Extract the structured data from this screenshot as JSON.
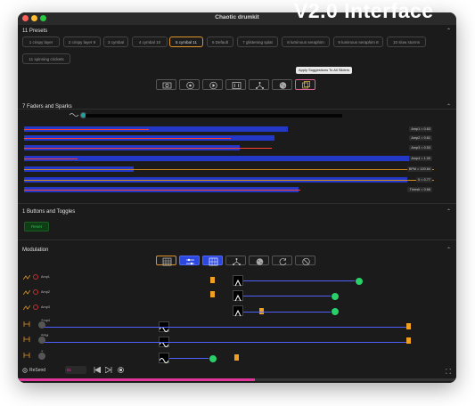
{
  "window": {
    "title": "Chaotic drumkit"
  },
  "overlay_text": "V2.0 Interface",
  "presets": {
    "section_title": "11 Presets",
    "items": [
      "1 crispy layer",
      "2 crispy layer 9",
      "3 cymbal",
      "4 cymbal 10",
      "5 cymbal 11",
      "6 Default",
      "7 glistening splat",
      "8 luminous seraphim",
      "9 luminous seraphim 8",
      "10 slow storms",
      "11 spinning crickets"
    ],
    "active_index": 4,
    "toolbar_icons": [
      "camera-icon",
      "record-icon",
      "play-icon",
      "sliders-icon",
      "graph-icon",
      "dice-icon",
      "suggest-icon"
    ],
    "tooltip": "Apply Suggestions To All Sliders"
  },
  "faders": {
    "section_title": "7 Faders and Sparks",
    "rows": [
      {
        "label": "Amp1 = 0.63",
        "value": 0.63
      },
      {
        "label": "Amp2 = 0.61",
        "value": 0.61
      },
      {
        "label": "Amp3 = 0.53",
        "value": 0.53
      },
      {
        "label": "Amp4 = 1.00",
        "value": 1.0
      },
      {
        "label": "BPM = 120.84",
        "value": 0.27
      },
      {
        "label": "X = 0.77",
        "value": 0.99
      },
      {
        "label": "Thresh = 0.66",
        "value": 0.66
      }
    ],
    "colors": {
      "bar": "#2438c8",
      "spark": "#ff4030"
    }
  },
  "buttons": {
    "section_title": "1 Buttons and Toggles",
    "reset_label": "Reset"
  },
  "modulation": {
    "section_title": "Modulation",
    "toolbar_icons": [
      "grid-icon",
      "sliders-toggle-icon",
      "matrix-icon",
      "graph-icon",
      "dice-icon",
      "refresh-icon",
      "clear-icon"
    ],
    "rows": [
      {
        "label": "Amp1"
      },
      {
        "label": "Amp2"
      },
      {
        "label": "Amp3"
      },
      {
        "label": "Amp4"
      },
      {
        "label": "BPM"
      },
      {
        "label": "X"
      }
    ]
  },
  "bottom": {
    "resend_label": "ReSend",
    "number_value": "81",
    "progress": 0.54
  }
}
